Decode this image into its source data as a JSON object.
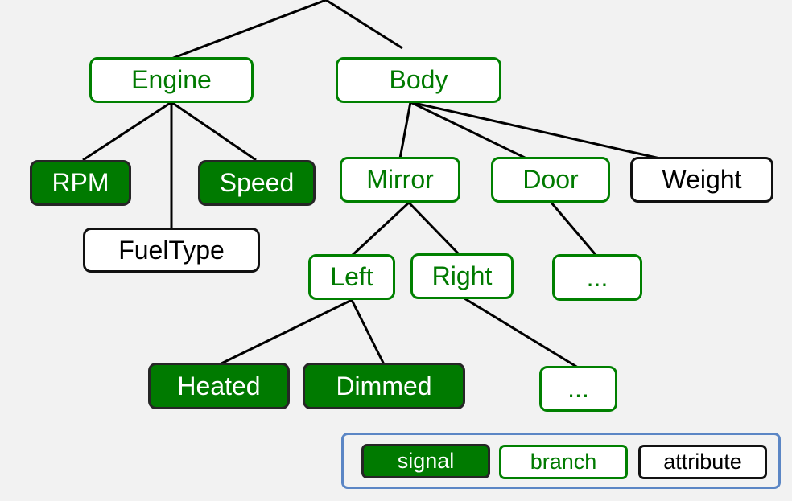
{
  "diagram": {
    "nodes": {
      "engine": {
        "label": "Engine",
        "type": "branch"
      },
      "body": {
        "label": "Body",
        "type": "branch"
      },
      "rpm": {
        "label": "RPM",
        "type": "signal"
      },
      "speed": {
        "label": "Speed",
        "type": "signal"
      },
      "fueltype": {
        "label": "FuelType",
        "type": "attribute"
      },
      "mirror": {
        "label": "Mirror",
        "type": "branch"
      },
      "door": {
        "label": "Door",
        "type": "branch"
      },
      "weight": {
        "label": "Weight",
        "type": "attribute"
      },
      "left": {
        "label": "Left",
        "type": "branch"
      },
      "right": {
        "label": "Right",
        "type": "branch"
      },
      "door_more": {
        "label": "...",
        "type": "branch"
      },
      "heated": {
        "label": "Heated",
        "type": "signal"
      },
      "dimmed": {
        "label": "Dimmed",
        "type": "signal"
      },
      "right_more": {
        "label": "...",
        "type": "branch"
      }
    },
    "edges": [
      [
        "root",
        "engine"
      ],
      [
        "root",
        "body"
      ],
      [
        "engine",
        "rpm"
      ],
      [
        "engine",
        "speed"
      ],
      [
        "engine",
        "fueltype"
      ],
      [
        "body",
        "mirror"
      ],
      [
        "body",
        "door"
      ],
      [
        "body",
        "weight"
      ],
      [
        "mirror",
        "left"
      ],
      [
        "mirror",
        "right"
      ],
      [
        "door",
        "door_more"
      ],
      [
        "left",
        "heated"
      ],
      [
        "left",
        "dimmed"
      ],
      [
        "right",
        "right_more"
      ]
    ]
  },
  "legend": {
    "signal": "signal",
    "branch": "branch",
    "attribute": "attribute"
  },
  "colors": {
    "branch_border": "#008000",
    "signal_fill": "#007a00",
    "attribute_border": "#111111",
    "legend_border": "#5b86c5",
    "background": "#f2f2f2"
  }
}
